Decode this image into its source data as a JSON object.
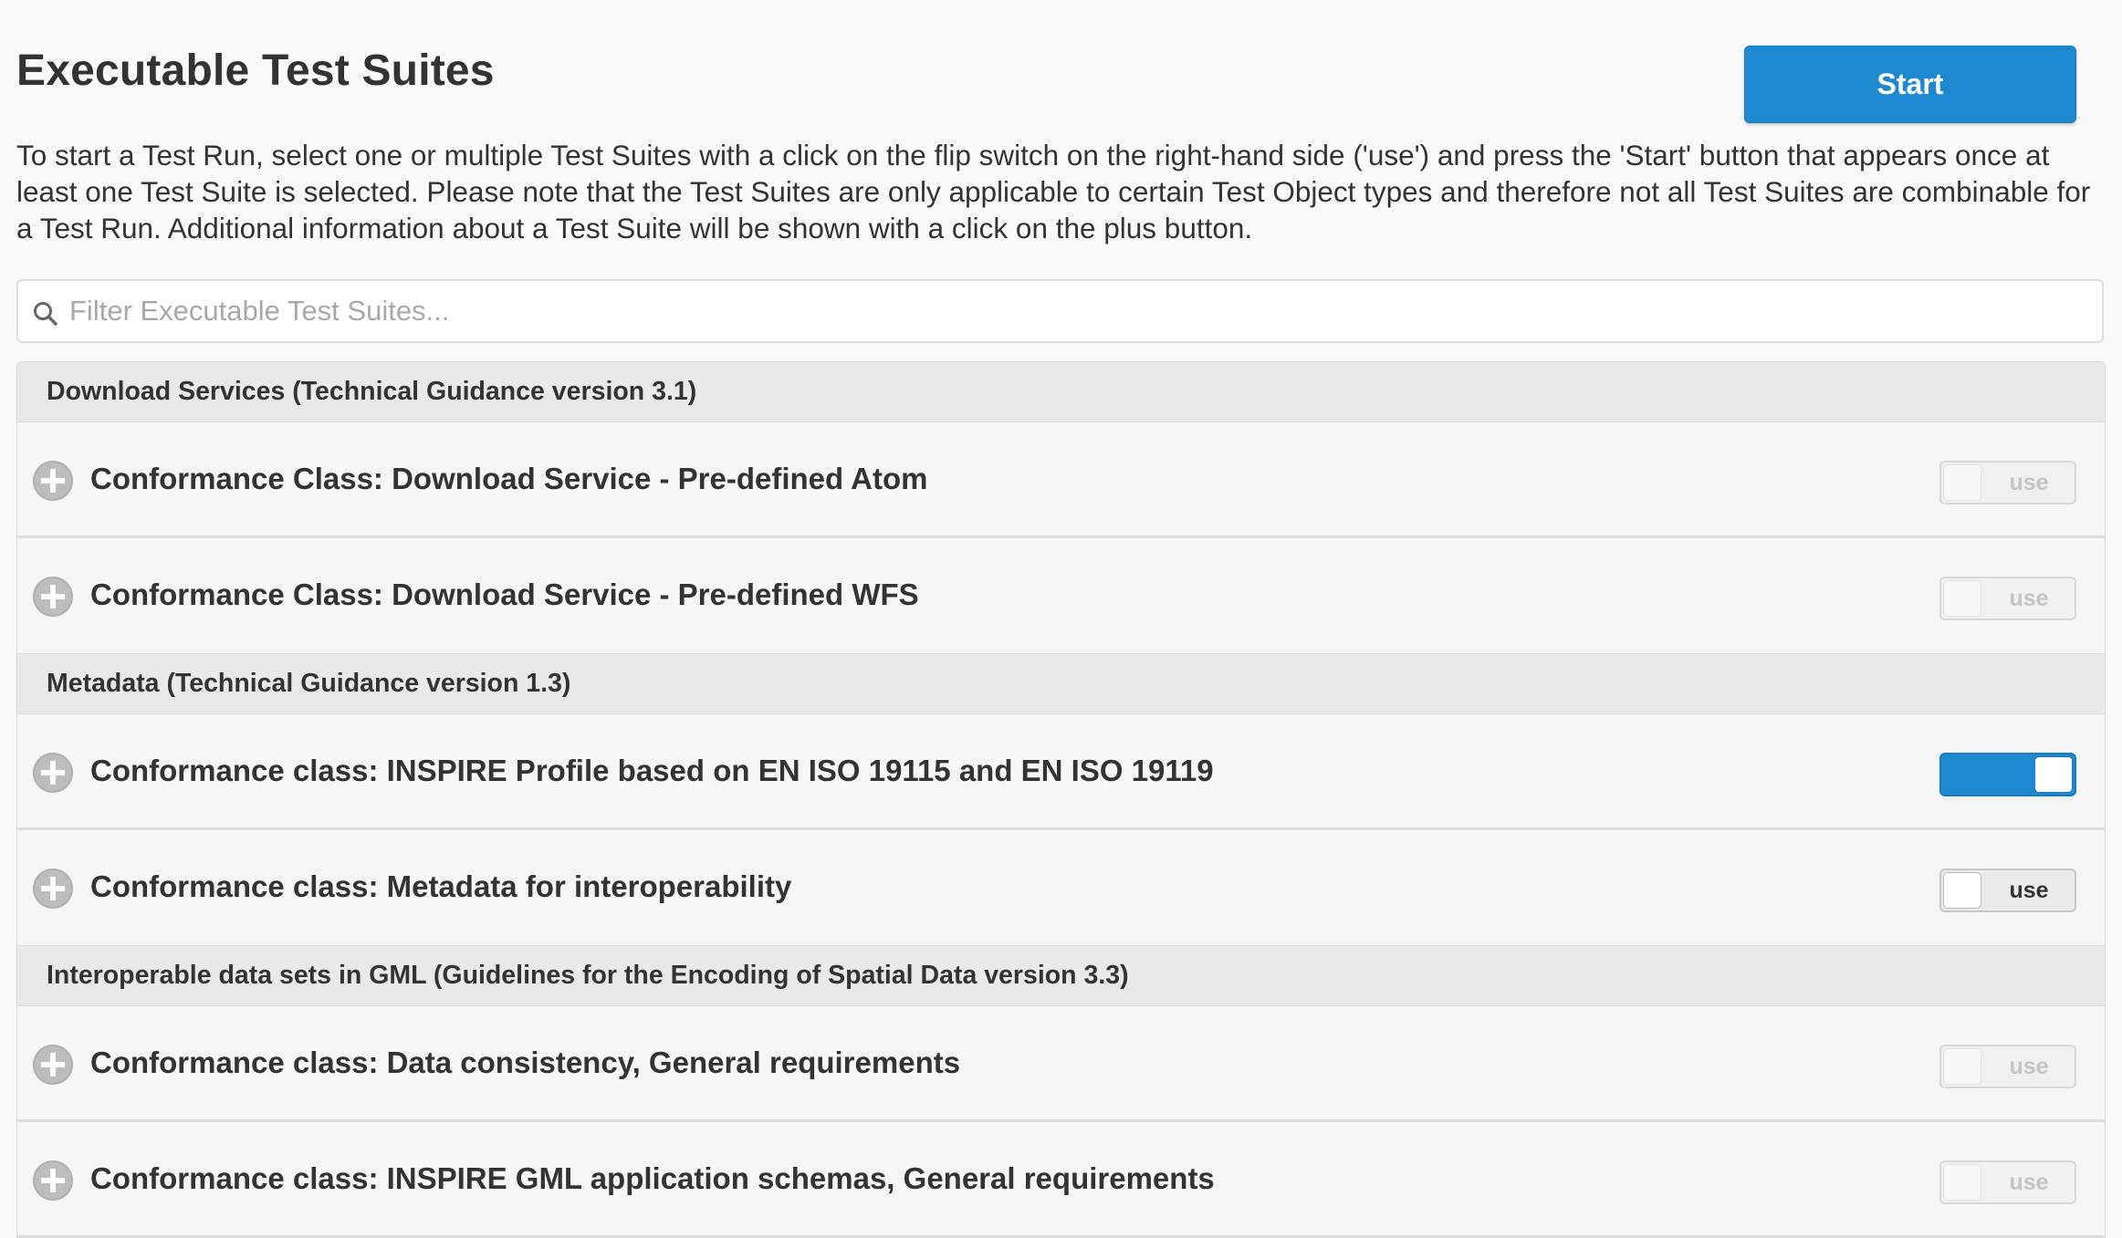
{
  "header": {
    "title": "Executable Test Suites",
    "start_label": "Start"
  },
  "intro": "To start a Test Run, select one or multiple Test Suites with a click on the flip switch on the right-hand side ('use') and press the 'Start' button that appears once at least one Test Suite is selected. Please note that the Test Suites are only applicable to certain Test Object types and therefore not all Test Suites are combinable for a Test Run. Additional information about a Test Suite will be shown with a click on the plus button.",
  "filter": {
    "placeholder": "Filter Executable Test Suites...",
    "value": ""
  },
  "groups": [
    {
      "title": "Download Services (Technical Guidance version 3.1)",
      "items": [
        {
          "title": "Conformance Class: Download Service - Pre-defined Atom",
          "toggle_label": "use",
          "state": "disabled"
        },
        {
          "title": "Conformance Class: Download Service - Pre-defined WFS",
          "toggle_label": "use",
          "state": "disabled"
        }
      ]
    },
    {
      "title": "Metadata (Technical Guidance version 1.3)",
      "items": [
        {
          "title": "Conformance class: INSPIRE Profile based on EN ISO 19115 and EN ISO 19119",
          "toggle_label": "",
          "state": "on"
        },
        {
          "title": "Conformance class: Metadata for interoperability",
          "toggle_label": "use",
          "state": "off"
        }
      ]
    },
    {
      "title": "Interoperable data sets in GML (Guidelines for the Encoding of Spatial Data version 3.3)",
      "items": [
        {
          "title": "Conformance class: Data consistency, General requirements",
          "toggle_label": "use",
          "state": "disabled"
        },
        {
          "title": "Conformance class: INSPIRE GML application schemas, General requirements",
          "toggle_label": "use",
          "state": "disabled"
        }
      ]
    }
  ],
  "colors": {
    "accent": "#1f89cf",
    "group_header_bg": "#e9e9e9",
    "row_bg": "#f6f6f6"
  }
}
